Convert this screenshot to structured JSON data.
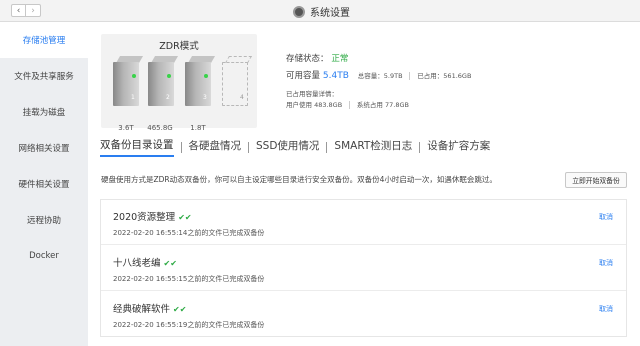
{
  "window": {
    "title": "系统设置",
    "back_icon": "‹",
    "forward_icon": "›"
  },
  "sidebar": {
    "items": [
      {
        "label": "存储池管理",
        "active": true
      },
      {
        "label": "文件及共享服务",
        "active": false
      },
      {
        "label": "挂载为磁盘",
        "active": false
      },
      {
        "label": "网络相关设置",
        "active": false
      },
      {
        "label": "硬件相关设置",
        "active": false
      },
      {
        "label": "远程协助",
        "active": false
      },
      {
        "label": "Docker",
        "active": false
      }
    ]
  },
  "zdr": {
    "title": "ZDR模式",
    "disks": [
      {
        "num": "1",
        "capacity": "3.6T",
        "present": true
      },
      {
        "num": "2",
        "capacity": "465.8G",
        "present": true
      },
      {
        "num": "3",
        "capacity": "1.8T",
        "present": true
      },
      {
        "num": "4",
        "capacity": "",
        "present": false
      }
    ]
  },
  "storage": {
    "status_label": "存储状态：",
    "status_value": "正常",
    "capacity_label": "可用容量",
    "capacity_value": "5.4TB",
    "total_label": "总容量：5.9TB",
    "used_label": "已占用：561.6GB",
    "detail_label": "已占用容量详情：",
    "user_used": "用户使用 483.8GB",
    "system_used": "系统占用 77.8GB"
  },
  "tabs": [
    {
      "label": "双备份目录设置",
      "active": true
    },
    {
      "label": "各硬盘情况",
      "active": false
    },
    {
      "label": "SSD使用情况",
      "active": false
    },
    {
      "label": "SMART检测日志",
      "active": false
    },
    {
      "label": "设备扩容方案",
      "active": false
    }
  ],
  "backup": {
    "description": "硬盘使用方式是ZDR动态双备份，你可以自主设定哪些目录进行安全双备份。双备份4小时启动一次，如遇休眠会跳过。",
    "start_button": "立即开始双备份",
    "check_icon": "✔✔",
    "cancel_label": "取消",
    "items": [
      {
        "name": "2020资源整理",
        "time": "2022-02-20 16:55:14之前的文件已完成双备份"
      },
      {
        "name": "十八线老编",
        "time": "2022-02-20 16:55:15之前的文件已完成双备份"
      },
      {
        "name": "经典破解软件",
        "time": "2022-02-20 16:55:19之前的文件已完成双备份"
      }
    ]
  },
  "colors": {
    "accent": "#2a7ef0",
    "success": "#2daa44",
    "sidebar_bg": "#eceef1"
  }
}
